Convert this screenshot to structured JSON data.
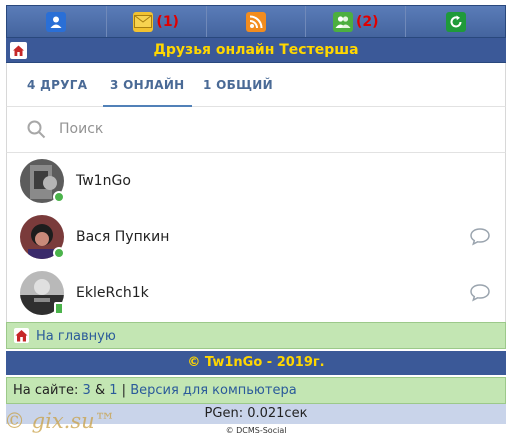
{
  "topbar": {
    "mail_count": "(1)",
    "friends_count": "(2)"
  },
  "title": "Друзья онлайн Тестерша",
  "tabs": [
    {
      "label": "4 ДРУГА"
    },
    {
      "label": "3 ОНЛАЙН"
    },
    {
      "label": "1 ОБЩИЙ"
    }
  ],
  "search": {
    "placeholder": "Поиск"
  },
  "friends": [
    {
      "name": "Tw1nGo",
      "status": "online"
    },
    {
      "name": "Вася Пупкин",
      "status": "online"
    },
    {
      "name": "EkleRch1k",
      "status": "mobile"
    }
  ],
  "footer": {
    "home_link": "На главную",
    "copyright": "© Tw1nGo - 2019г.",
    "online_prefix": "На сайте:",
    "online_count": "3",
    "amp": "&",
    "online_count2": "1",
    "sep": "|",
    "desktop_link": "Версия для компьютера",
    "pgen": "PGen: 0.021сек",
    "engine": "© DCMS-Social",
    "watermark": "© gix.su™"
  },
  "colors": {
    "accent": "#3b5998",
    "title_text": "#ffd700",
    "green_bar": "#c3e6b3",
    "online_dot": "#4bb34b"
  }
}
